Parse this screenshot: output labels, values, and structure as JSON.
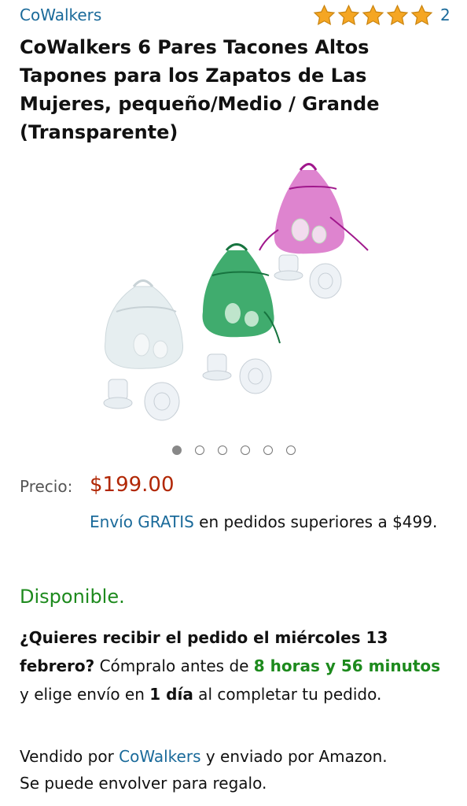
{
  "brand": "CoWalkers",
  "rating": {
    "stars": 5,
    "count": "2",
    "star_color": "#f5a623"
  },
  "title": "CoWalkers 6 Pares Tacones Altos Tapones para los Zapatos de Las Mujeres, pequeño/Medio / Grande (Transparente)",
  "carousel": {
    "total": 6,
    "active": 1
  },
  "price": {
    "label": "Precio:",
    "value": "$199.00",
    "color": "#b12704"
  },
  "shipping": {
    "link": "Envío GRATIS",
    "text": " en pedidos superiores a $499."
  },
  "availability": {
    "text": "Disponible.",
    "color": "#1d8a1d"
  },
  "delivery": {
    "question": "¿Quieres recibir el pedido el miércoles 13 febrero?",
    "before": " Cómpralo antes de ",
    "countdown": "8 horas y 56 minutos",
    "middle": " y elige envío en ",
    "speed": "1 día",
    "after": " al completar tu pedido."
  },
  "seller": {
    "prefix": "Vendido por ",
    "name": "CoWalkers",
    "suffix": " y enviado por Amazon.",
    "gift": "Se puede envolver para regalo."
  },
  "colors": {
    "link": "#1a6a9a",
    "bag_white": "#e6eef0",
    "bag_green": "#1f9e55",
    "bag_pink": "#c21fa8"
  }
}
